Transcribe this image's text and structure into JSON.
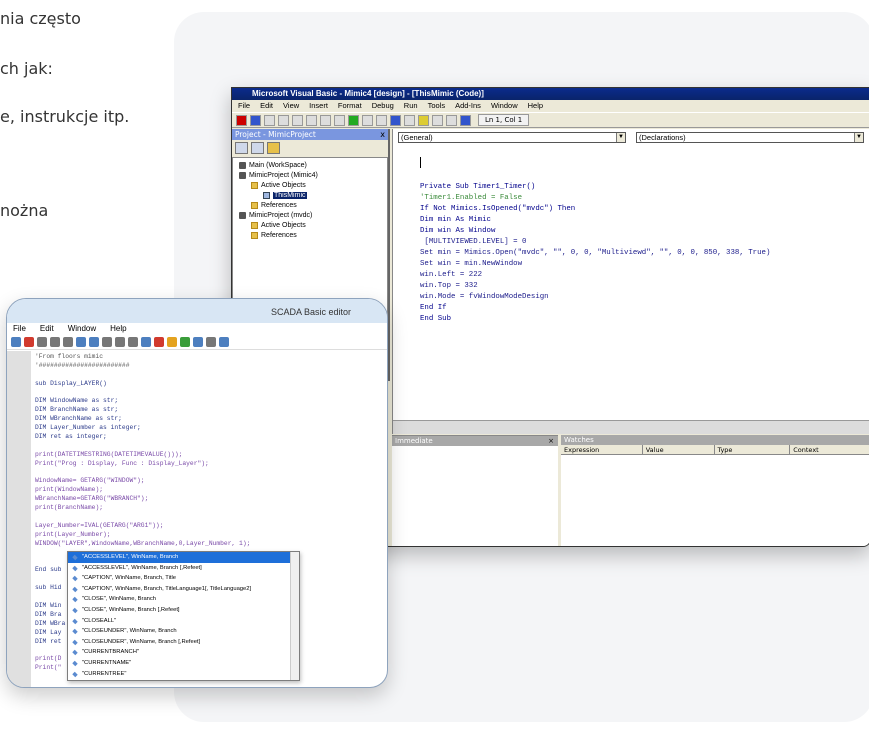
{
  "article": {
    "lines": [
      "nia często",
      "ch jak:",
      "e, instrukcje itp.",
      "nożna"
    ]
  },
  "vb": {
    "title": "Microsoft Visual Basic - Mimic4 [design] - [ThisMimic (Code)]",
    "menu": [
      "File",
      "Edit",
      "View",
      "Insert",
      "Format",
      "Debug",
      "Run",
      "Tools",
      "Add-Ins",
      "Window",
      "Help"
    ],
    "cursor_pos": "Ln 1, Col 1",
    "project_title": "Project - MimicProject",
    "project_close": "x",
    "tree": [
      {
        "label": "Main (WorkSpace)",
        "kind": "proj"
      },
      {
        "label": "MimicProject (Mimic4)",
        "kind": "proj"
      },
      {
        "label": "Active Objects",
        "kind": "fold"
      },
      {
        "label": "ThisMimic",
        "kind": "sel"
      },
      {
        "label": "References",
        "kind": "fold"
      },
      {
        "label": "MimicProject (mvdc)",
        "kind": "proj"
      },
      {
        "label": "Active Objects",
        "kind": "fold"
      },
      {
        "label": "References",
        "kind": "fold"
      }
    ],
    "combo_object": "(General)",
    "combo_proc": "(Declarations)",
    "code": [
      "Private Sub Timer1_Timer()",
      "'Timer1.Enabled = False",
      "If Not Mimics.IsOpened(\"mvdc\") Then",
      "Dim min As Mimic",
      "Dim win As Window",
      " [MULTIVIEWED.LEVEL] = 0",
      "Set min = Mimics.Open(\"mvdc\", \"\", 0, 0, \"Multiviewd\", \"\", 0, 0, 850, 338, True)",
      "Set win = min.NewWindow",
      "win.Left = 222",
      "win.Top = 332",
      "win.Mode = fvWindowModeDesign",
      "End If",
      "End Sub"
    ],
    "immediate_title": "Immediate",
    "watches_title": "Watches",
    "watch_cols": [
      "Expression",
      "Value",
      "Type",
      "Context"
    ]
  },
  "scada": {
    "title": "SCADA Basic editor",
    "menu": [
      "File",
      "Edit",
      "Window",
      "Help"
    ],
    "code": [
      "'From floors mimic",
      "'########################",
      "",
      "sub Display_LAYER()",
      "",
      "DIM WindowName as str;",
      "DIM BranchName as str;",
      "DIM WBranchName as str;",
      "DIM Layer_Number as integer;",
      "DIM ret as integer;",
      "",
      "print(DATETIMESTRING(DATETIMEVALUE()));",
      "Print(\"Prog : Display, Func : Display_Layer\");",
      "",
      "WindowName= GETARG(\"WINDOW\");",
      "print(WindowName);",
      "WBranchName=GETARG(\"WBRANCH\");",
      "print(BranchName);",
      "",
      "Layer_Number=IVAL(GETARG(\"ARG1\"));",
      "print(Layer_Number);",
      "WINDOW(\"LAYER\",WindowName,WBranchName,0,Layer_Number, 1);",
      "",
      "",
      "End sub",
      "",
      "sub Hid",
      "",
      "DIM Win",
      "DIM Bra",
      "DIM WBra",
      "DIM Lay",
      "DIM ret",
      "",
      "print(D",
      "Print(\""
    ],
    "autocomplete": [
      "\"ACCESSLEVEL\", WinName, Branch",
      "\"ACCESSLEVEL\", WinName, Branch [,Refeet]",
      "\"CAPTION\", WinName, Branch, Title",
      "\"CAPTION\", WinName, Branch, TitleLanguage1[, TitleLanguage2]",
      "\"CLOSE\", WinName, Branch",
      "\"CLOSE\", WinName, Branch [,Refeet]",
      "\"CLOSEALL\"",
      "\"CLOSEUNDER\", WinName, Branch",
      "\"CLOSEUNDER\", WinName, Branch [,Refeet]",
      "\"CURRENTBRANCH\"",
      "\"CURRENTNAME\"",
      "\"CURRENTREE\""
    ]
  }
}
